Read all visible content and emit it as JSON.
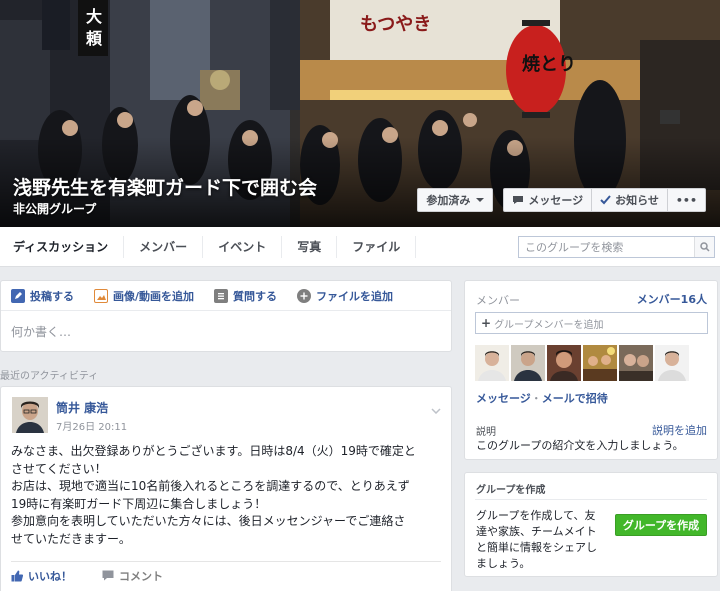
{
  "cover": {
    "title": "浅野先生を有楽町ガード下で囲む会",
    "subtitle": "非公開グループ",
    "buttons": {
      "joined": "参加済み",
      "message": "メッセージ",
      "notifications": "お知らせ",
      "more": "•••"
    },
    "signs": {
      "lantern": "焼とり",
      "vertical_sign": "大",
      "vertical_sign2": "頼",
      "banner": "もつやき"
    }
  },
  "nav": {
    "tabs": [
      "ディスカッション",
      "メンバー",
      "イベント",
      "写真",
      "ファイル"
    ],
    "search_placeholder": "このグループを検索"
  },
  "composer": {
    "actions": [
      "投稿する",
      "画像/動画を追加",
      "質問する",
      "ファイルを追加"
    ],
    "placeholder": "何か書く…"
  },
  "recent_activity_label": "最近のアクティビティ",
  "post": {
    "author": "筒井 康浩",
    "time": "7月26日 20:11",
    "body_lines": [
      "みなさま、出欠登録ありがとうございます。日時は8/4（火）19時で確定と",
      "させてください！",
      "お店は、現地で適当に10名前後入れるところを調達するので、とりあえず",
      "19時に有楽町ガード下周辺に集合しましょう！",
      "参加意向を表明していただいた方々には、後日メッセンジャーでご連絡さ",
      "せていただきますー。"
    ],
    "like_label": "いいね！",
    "comment_label": "コメント"
  },
  "members": {
    "heading": "メンバー",
    "count_label": "メンバー16人",
    "add_placeholder": "グループメンバーを追加",
    "links": {
      "message": "メッセージ",
      "separator": "・",
      "invite": "メールで招待"
    },
    "description_heading": "説明",
    "description_add": "説明を追加",
    "description_text": "このグループの紹介文を入力しましょう。"
  },
  "create_group": {
    "heading": "グループを作成",
    "description_lines": [
      "グループを作成して、友",
      "達や家族、チームメイト",
      "と簡単に情報をシェアし",
      "ましょう。"
    ],
    "button": "グループを作成"
  },
  "colors": {
    "link": "#365899",
    "green_button": "#42b72a",
    "page_bg": "#e9ebee"
  }
}
